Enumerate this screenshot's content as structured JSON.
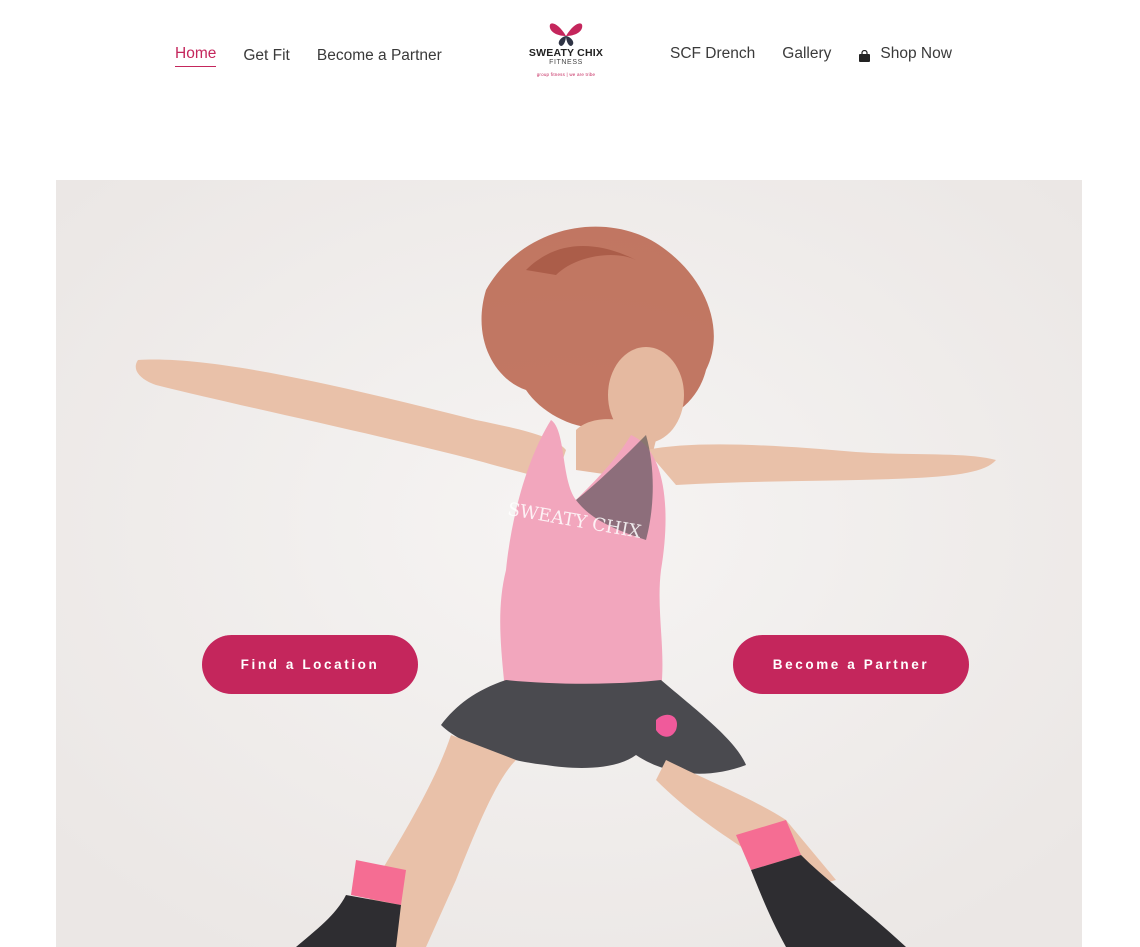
{
  "nav": {
    "left": [
      {
        "label": "Home",
        "active": true
      },
      {
        "label": "Get Fit",
        "active": false
      },
      {
        "label": "Become a Partner",
        "active": false
      }
    ],
    "right": [
      {
        "label": "SCF Drench"
      },
      {
        "label": "Gallery"
      },
      {
        "label": "Shop Now",
        "icon": "shopping-bag-icon"
      }
    ]
  },
  "logo": {
    "title": "SWEATY CHIX",
    "subtitle": "FITNESS",
    "tagline": "group fitness | we are tribe",
    "icon": "butterfly-icon"
  },
  "hero": {
    "shirt_text": "SWEATY CHIX",
    "buttons": {
      "find_location": "Find a Location",
      "become_partner": "Become a Partner"
    }
  },
  "colors": {
    "accent": "#c4265c",
    "nav_text": "#3a3a3a",
    "hero_bg": "#f1eeec"
  }
}
